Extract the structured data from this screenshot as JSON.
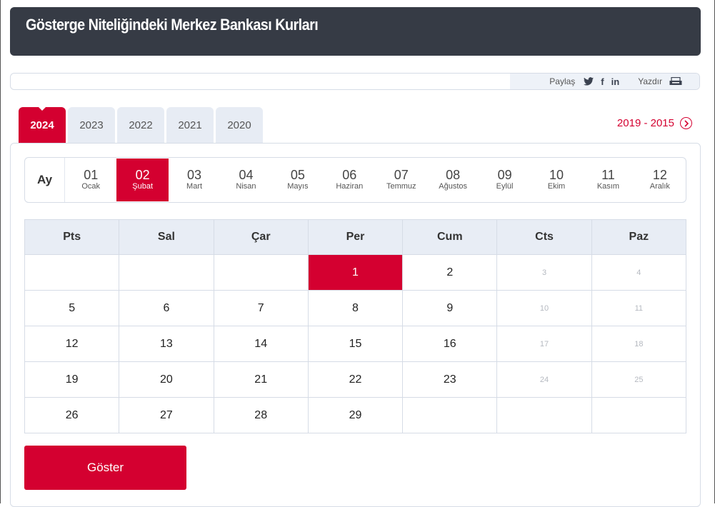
{
  "header": {
    "title": "Gösterge Niteliğindeki Merkez Bankası Kurları"
  },
  "share": {
    "label": "Paylaş",
    "print_label": "Yazdır",
    "icons": [
      "twitter-icon",
      "facebook-icon",
      "linkedin-icon",
      "printer-icon"
    ]
  },
  "years": {
    "tabs": [
      "2024",
      "2023",
      "2022",
      "2021",
      "2020"
    ],
    "active": "2024",
    "range_label": "2019 - 2015"
  },
  "months": {
    "header": "Ay",
    "items": [
      {
        "num": "01",
        "name": "Ocak"
      },
      {
        "num": "02",
        "name": "Şubat"
      },
      {
        "num": "03",
        "name": "Mart"
      },
      {
        "num": "04",
        "name": "Nisan"
      },
      {
        "num": "05",
        "name": "Mayıs"
      },
      {
        "num": "06",
        "name": "Haziran"
      },
      {
        "num": "07",
        "name": "Temmuz"
      },
      {
        "num": "08",
        "name": "Ağustos"
      },
      {
        "num": "09",
        "name": "Eylül"
      },
      {
        "num": "10",
        "name": "Ekim"
      },
      {
        "num": "11",
        "name": "Kasım"
      },
      {
        "num": "12",
        "name": "Aralık"
      }
    ],
    "active_index": 1
  },
  "calendar": {
    "weekdays": [
      "Pts",
      "Sal",
      "Çar",
      "Per",
      "Cum",
      "Cts",
      "Paz"
    ],
    "weeks": [
      [
        "",
        "",
        "",
        "1",
        "2",
        "3",
        "4"
      ],
      [
        "5",
        "6",
        "7",
        "8",
        "9",
        "10",
        "11"
      ],
      [
        "12",
        "13",
        "14",
        "15",
        "16",
        "17",
        "18"
      ],
      [
        "19",
        "20",
        "21",
        "22",
        "23",
        "24",
        "25"
      ],
      [
        "26",
        "27",
        "28",
        "29",
        "",
        "",
        ""
      ]
    ],
    "selected_day": "1"
  },
  "actions": {
    "show_label": "Göster"
  },
  "colors": {
    "accent": "#d40030",
    "header_bg": "#363b45",
    "tab_bg": "#e7ecf4",
    "table_head_bg": "#e8edf5"
  }
}
